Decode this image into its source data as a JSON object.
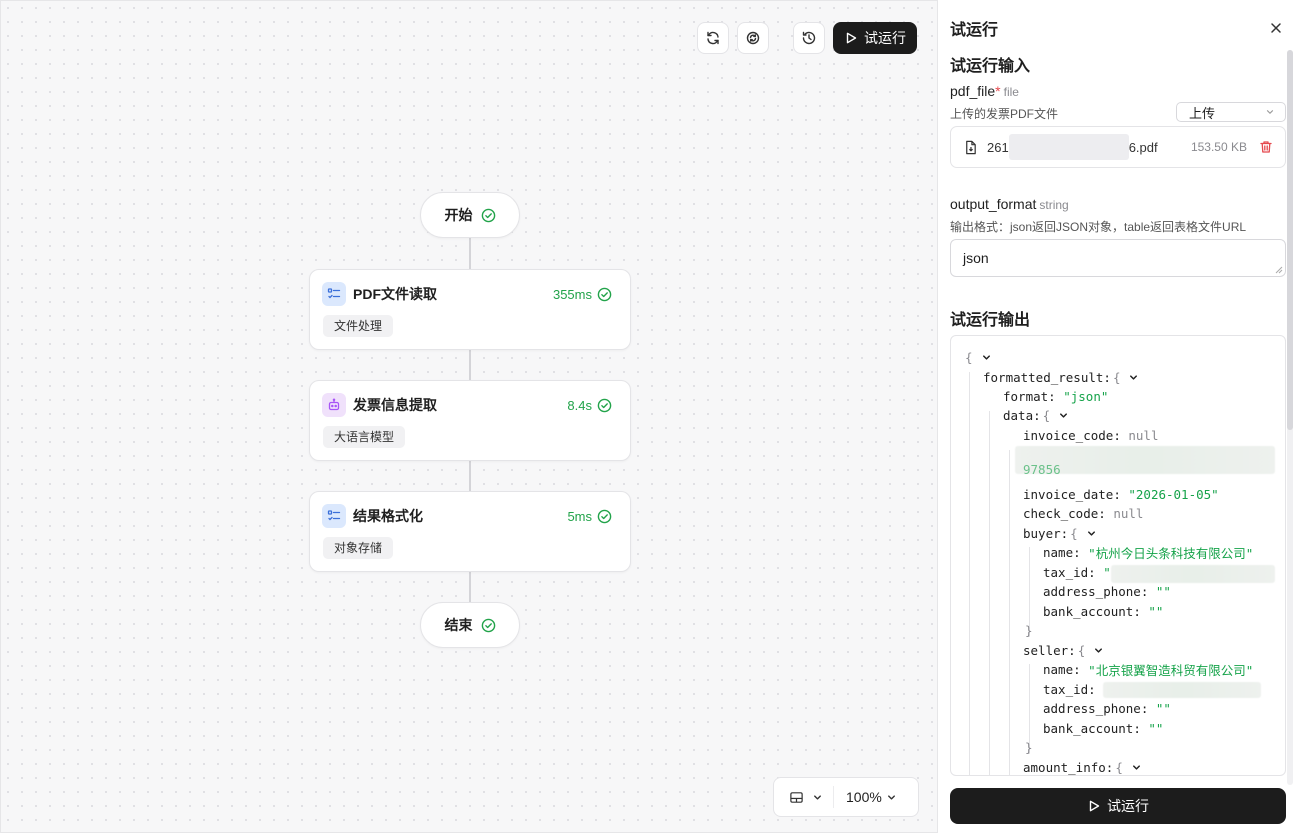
{
  "toolbar": {
    "run_label": "试运行"
  },
  "workflow": {
    "start_label": "开始",
    "end_label": "结束",
    "nodes": [
      {
        "title": "PDF文件读取",
        "time": "355ms",
        "tag": "文件处理",
        "icon": "list-tool-icon"
      },
      {
        "title": "发票信息提取",
        "time": "8.4s",
        "tag": "大语言模型",
        "icon": "robot-icon"
      },
      {
        "title": "结果格式化",
        "time": "5ms",
        "tag": "对象存储",
        "icon": "list-tool-icon"
      }
    ]
  },
  "zoom": {
    "value": "100%"
  },
  "panel": {
    "title": "试运行",
    "input_title": "试运行输入",
    "pdf_field": {
      "name": "pdf_file",
      "required_mark": "*",
      "type": "file",
      "desc": "上传的发票PDF文件",
      "select_value": "上传",
      "file_prefix": "261",
      "file_suffix": "6.pdf",
      "file_size": "153.50 KB"
    },
    "format_field": {
      "name": "output_format",
      "type": "string",
      "desc": "输出格式：json返回JSON对象，table返回表格文件URL",
      "value": "json"
    },
    "output_title": "试运行输出",
    "run_label": "试运行"
  },
  "output": {
    "open_brace": "{",
    "close_brace": "}",
    "formatted_result_key": "formatted_result",
    "format_key": "format",
    "format_value": "\"json\"",
    "data_key": "data",
    "invoice_code_key": "invoice_code",
    "invoice_code_value": "null",
    "partial_value": "97856",
    "invoice_date_key": "invoice_date",
    "invoice_date_value": "\"2026-01-05\"",
    "check_code_key": "check_code",
    "check_code_value": "null",
    "buyer_key": "buyer",
    "buyer_name": "\"杭州今日头条科技有限公司\"",
    "tax_id_key": "tax_id",
    "tax_id_open": "\"",
    "name_key": "name",
    "address_phone_key": "address_phone",
    "bank_account_key": "bank_account",
    "empty_string": "\"\"",
    "seller_key": "seller",
    "seller_name": "\"北京银翼智造科贸有限公司\"",
    "amount_info_key": "amount_info",
    "colon": ":"
  },
  "colors": {
    "success": "#22a34a",
    "dark_button": "#1c1c1c",
    "string_value": "#16a34a",
    "delete": "#e5484d"
  }
}
